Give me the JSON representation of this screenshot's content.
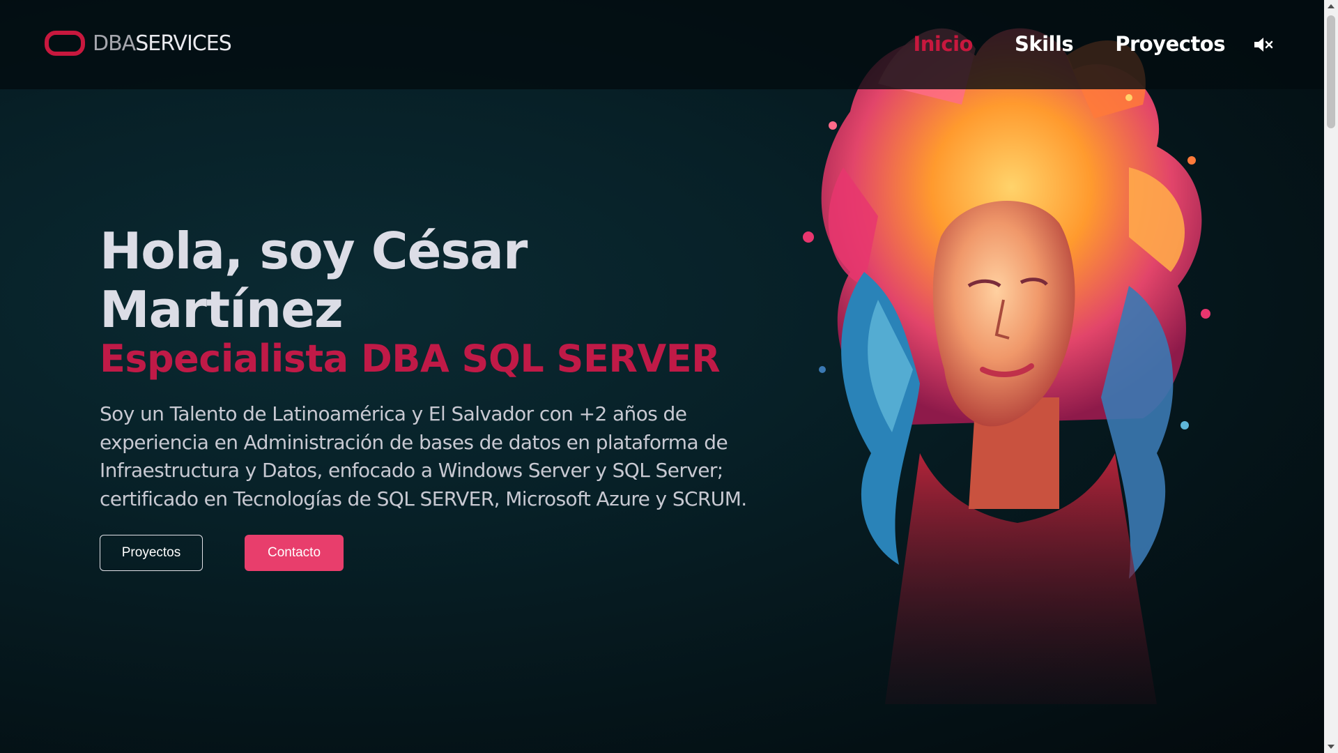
{
  "logo": {
    "prefix": "DBA",
    "suffix": "SERVICES",
    "icon": "pill-shape-icon",
    "color": "#c8183e"
  },
  "nav": {
    "items": [
      {
        "label": "Inicio",
        "active": true
      },
      {
        "label": "Skills",
        "active": false
      },
      {
        "label": "Proyectos",
        "active": false
      }
    ],
    "mute_icon": "speaker-muted-icon"
  },
  "hero": {
    "greeting": "Hola, soy César Martínez",
    "role": "Especialista DBA SQL SERVER",
    "description": "Soy un Talento de Latinoamérica y El Salvador con +2 años de experiencia en Administración de bases de datos en plataforma de Infraestructura y Datos, enfocado a Windows Server y SQL Server; certificado en Tecnologías de SQL SERVER, Microsoft Azure y SCRUM.",
    "buttons": {
      "projects": "Proyectos",
      "contact": "Contacto"
    },
    "illustration": "colorful-woman-portrait-illustration"
  },
  "colors": {
    "accent": "#c8183e",
    "button_primary": "#e83e6c",
    "background": "#061318",
    "text": "#dcdde6"
  }
}
